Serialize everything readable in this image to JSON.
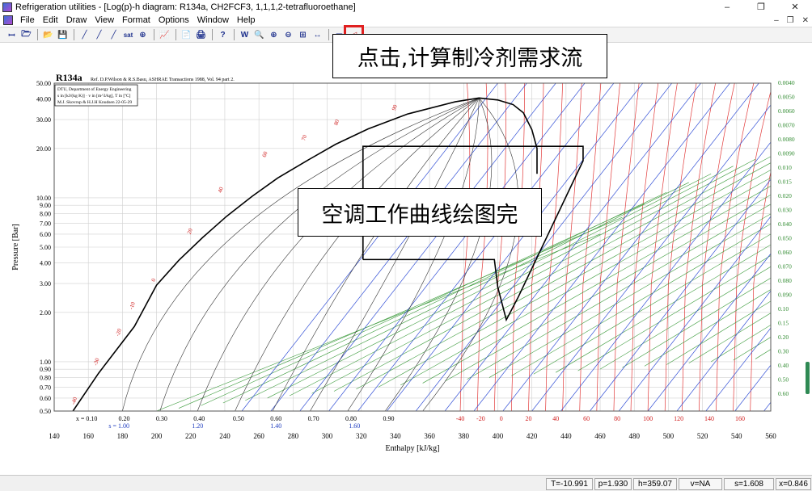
{
  "window": {
    "title": "Refrigeration utilities - [Log(p)-h diagram: R134a, CH2FCF3, 1,1,1,2-tetrafluoroethane]",
    "controls": [
      "–",
      "❐",
      "✕"
    ],
    "mdi_controls": [
      "–",
      "❐",
      "✕"
    ]
  },
  "menu": [
    "File",
    "Edit",
    "Draw",
    "View",
    "Format",
    "Options",
    "Window",
    "Help"
  ],
  "toolbar": {
    "buttons": [
      "ꟷ",
      "🗁",
      "📂",
      "💾",
      "╱",
      "╱",
      "╱",
      "sat",
      "⊕",
      "📈",
      "📄",
      "🖨",
      "?",
      "W",
      "🔍",
      "⊕",
      "⊖",
      "⊞",
      "↔",
      "▭",
      "◁"
    ],
    "highlighted_index": 20
  },
  "callouts": {
    "top": "点击,计算制冷剂需求流",
    "middle": "空调工作曲线绘图完"
  },
  "status": [
    "T=-10.991",
    "p=1.930",
    "h=359.07",
    "v=NA",
    "s=1.608",
    "x=0.846"
  ],
  "chart_data": {
    "type": "line",
    "refrigerant": "R134a",
    "reference_text": "Ref. D.P.Wilson & R.S.Basu, ASHRAE Transactions 1988, Vol. 94 part 2.",
    "info_box": [
      "DTU, Department of Energy Engineering",
      "s in [kJ/(kg K)] · v in [m^3/kg], T in [ºC]",
      "M.J. Skovrup & H.J.H Knudsen  22-05-29"
    ],
    "xlabel": "Enthalpy [kJ/kg]",
    "ylabel": "Pressure [Bar]",
    "xlim": [
      140,
      560
    ],
    "ylim": [
      0.5,
      50
    ],
    "yscale": "log",
    "x_ticks": [
      140,
      160,
      180,
      200,
      220,
      240,
      260,
      280,
      300,
      320,
      340,
      360,
      380,
      400,
      420,
      440,
      460,
      480,
      500,
      520,
      540,
      560
    ],
    "y_ticks": [
      {
        "v": 50,
        "l": "50.00"
      },
      {
        "v": 40,
        "l": "40.00"
      },
      {
        "v": 30,
        "l": "30.00"
      },
      {
        "v": 20,
        "l": "20.00"
      },
      {
        "v": 10,
        "l": "10.00"
      },
      {
        "v": 9,
        "l": "9.00"
      },
      {
        "v": 8,
        "l": "8.00"
      },
      {
        "v": 7,
        "l": "7.00"
      },
      {
        "v": 6,
        "l": "6.00"
      },
      {
        "v": 5,
        "l": "5.00"
      },
      {
        "v": 4,
        "l": "4.00"
      },
      {
        "v": 3,
        "l": "3.00"
      },
      {
        "v": 2,
        "l": "2.00"
      },
      {
        "v": 1,
        "l": "1.00"
      },
      {
        "v": 0.9,
        "l": "0.90"
      },
      {
        "v": 0.8,
        "l": "0.80"
      },
      {
        "v": 0.7,
        "l": "0.70"
      },
      {
        "v": 0.6,
        "l": "0.60"
      },
      {
        "v": 0.5,
        "l": "0.50"
      }
    ],
    "saturation_liquid": [
      [
        151,
        0.5
      ],
      [
        166,
        0.85
      ],
      [
        187,
        1.64
      ],
      [
        200,
        2.93
      ],
      [
        213,
        4.15
      ],
      [
        227,
        5.72
      ],
      [
        241,
        7.7
      ],
      [
        256,
        10.2
      ],
      [
        271,
        13.2
      ],
      [
        288,
        16.8
      ],
      [
        305,
        21.2
      ],
      [
        324,
        26.3
      ],
      [
        347,
        32.4
      ],
      [
        375,
        38.5
      ],
      [
        389,
        40.6
      ]
    ],
    "saturation_vapor": [
      [
        389,
        40.6
      ],
      [
        400,
        39.5
      ],
      [
        409,
        37
      ],
      [
        415,
        33
      ],
      [
        420,
        26
      ],
      [
        423,
        20
      ],
      [
        423,
        14
      ]
    ],
    "quality_labels": [
      {
        "x": 159,
        "l": "x = 0.10"
      },
      {
        "x": 181,
        "l": "0.20"
      },
      {
        "x": 203,
        "l": "0.30"
      },
      {
        "x": 225,
        "l": "0.40"
      },
      {
        "x": 248,
        "l": "0.50"
      },
      {
        "x": 270,
        "l": "0.60"
      },
      {
        "x": 292,
        "l": "0.70"
      },
      {
        "x": 314,
        "l": "0.80"
      },
      {
        "x": 336,
        "l": "0.90"
      }
    ],
    "entropy_labels_bottom": [
      {
        "x": 178,
        "l": "s = 1.00"
      },
      {
        "x": 224,
        "l": "1.20"
      },
      {
        "x": 270,
        "l": "1.40"
      },
      {
        "x": 316,
        "l": "1.60"
      }
    ],
    "temperature_labels_bottom": [
      "-40",
      "-20",
      "0",
      "20",
      "40",
      "60",
      "80",
      "100",
      "120",
      "140",
      "160"
    ],
    "temperature_label_x": [
      378,
      390,
      402,
      418,
      434,
      452,
      470,
      488,
      506,
      524,
      542
    ],
    "temperature_labels_left": [
      {
        "x": 150,
        "p": 0.52,
        "l": "-40"
      },
      {
        "x": 163,
        "p": 0.9,
        "l": "-30"
      },
      {
        "x": 176,
        "p": 1.36,
        "l": "-20"
      },
      {
        "x": 184,
        "p": 1.98,
        "l": "-10"
      },
      {
        "x": 197,
        "p": 2.93,
        "l": "0"
      },
      {
        "x": 218,
        "p": 5.7,
        "l": "20"
      },
      {
        "x": 236,
        "p": 10.2,
        "l": "40"
      },
      {
        "x": 262,
        "p": 16.8,
        "l": "60"
      },
      {
        "x": 285,
        "p": 21.2,
        "l": "70"
      },
      {
        "x": 304,
        "p": 26.3,
        "l": "80"
      },
      {
        "x": 338,
        "p": 32.4,
        "l": "90"
      }
    ],
    "specific_volume_labels_right": [
      "0.0040",
      "0.0050",
      "0.0060",
      "0.0070",
      "0.0080",
      "0.0090",
      "0.010",
      "0.015",
      "0.020",
      "0.030",
      "0.040",
      "0.050",
      "0.060",
      "0.070",
      "0.080",
      "0.090",
      "0.10",
      "0.15",
      "0.20",
      "0.30",
      "0.40",
      "0.50",
      "0.60"
    ],
    "cycle": [
      [
        321,
        4.2
      ],
      [
        398,
        4.2
      ],
      [
        400,
        2.85
      ],
      [
        405,
        1.8
      ],
      [
        412,
        2.48
      ],
      [
        450,
        16.8
      ],
      [
        450,
        20.6
      ],
      [
        321,
        20.6
      ],
      [
        321,
        4.2
      ]
    ],
    "cycle_label_connector": [
      [
        398,
        4.2
      ],
      [
        398,
        2.85
      ]
    ]
  }
}
